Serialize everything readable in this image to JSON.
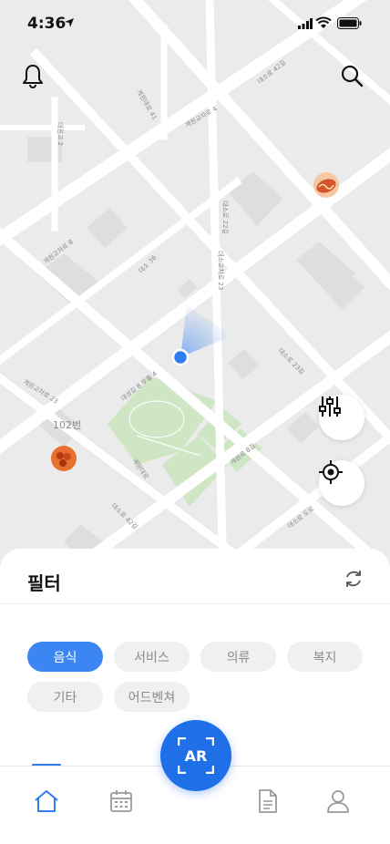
{
  "status_bar": {
    "time": "4:36"
  },
  "map": {
    "road_labels": [
      "대소로 42길",
      "계원교차로 4",
      "계원대로 41",
      "대소로 22길",
      "대원고 2",
      "계원교차로 8",
      "대소 36",
      "대소교차로 23",
      "대소로 23길",
      "대성길 8 부출 4",
      "계원교차로 23",
      "계원대로",
      "대소로 42길",
      "계원로 8길",
      "대소로 도로"
    ],
    "building_label": "102번"
  },
  "bottom_sheet": {
    "title": "필터",
    "chips": [
      {
        "label": "음식",
        "active": true
      },
      {
        "label": "서비스",
        "active": false
      },
      {
        "label": "의류",
        "active": false
      },
      {
        "label": "복지",
        "active": false
      },
      {
        "label": "기타",
        "active": false
      },
      {
        "label": "어드벤쳐",
        "active": false
      }
    ]
  },
  "ar_button": {
    "label": "AR"
  },
  "colors": {
    "accent": "#3b86f2",
    "ar": "#1f6fe8",
    "park": "#cfe6c5",
    "road": "#ffffff",
    "map_bg": "#ebebeb"
  },
  "tabs": [
    {
      "icon": "home-icon",
      "active": true
    },
    {
      "icon": "calendar-icon",
      "active": false
    },
    {
      "icon": "document-icon",
      "active": false
    },
    {
      "icon": "profile-icon",
      "active": false
    }
  ]
}
